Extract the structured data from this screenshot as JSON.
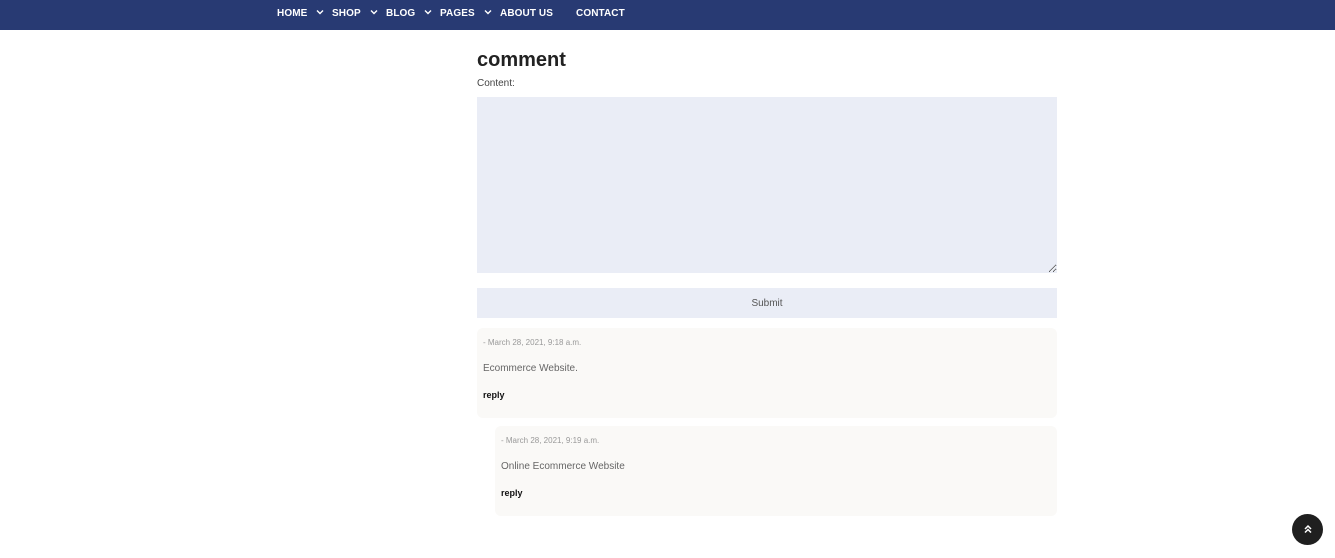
{
  "nav": {
    "items": [
      {
        "label": "HOME",
        "has_dropdown": true
      },
      {
        "label": "SHOP",
        "has_dropdown": true
      },
      {
        "label": "BLOG",
        "has_dropdown": true
      },
      {
        "label": "PAGES",
        "has_dropdown": true
      },
      {
        "label": "ABOUT US",
        "has_dropdown": false
      },
      {
        "label": "CONTACT",
        "has_dropdown": false
      }
    ],
    "background_color": "#283a73",
    "dropdown_icon": "chevron-down-icon"
  },
  "form": {
    "heading": "comment",
    "content_label": "Content:",
    "content_value": "",
    "submit_label": "Submit",
    "field_background": "#eaedf6"
  },
  "comments": [
    {
      "meta": "- March 28, 2021, 9:18 a.m.",
      "body": "Ecommerce Website.",
      "reply_label": "reply"
    },
    {
      "meta": "- March 28, 2021, 9:19 a.m.",
      "body": "Online Ecommerce Website",
      "reply_label": "reply",
      "is_reply": true
    }
  ],
  "scroll_top": {
    "icon": "double-chevron-up-icon"
  }
}
